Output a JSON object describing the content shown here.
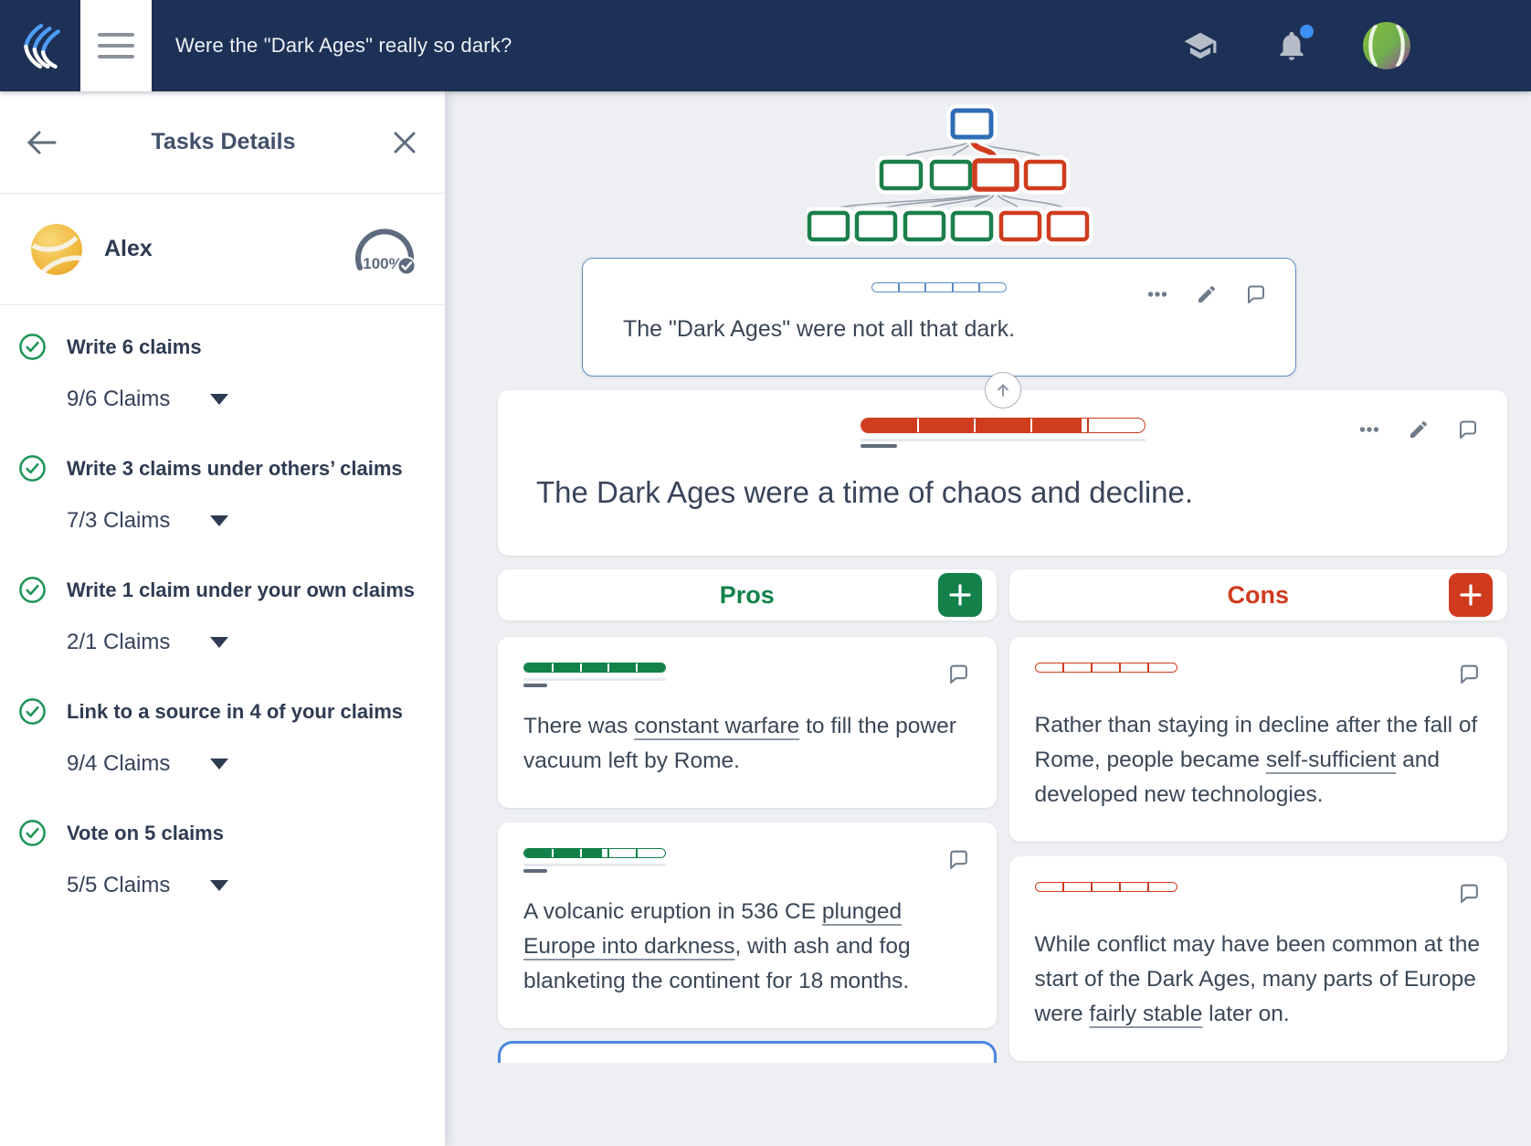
{
  "topbar": {
    "title": "Were the \"Dark Ages\" really so dark?",
    "icons": [
      "hamburger-menu",
      "school-cap",
      "notifications-bell",
      "user-avatar"
    ]
  },
  "sidebar": {
    "header": {
      "title": "Tasks Details"
    },
    "user": {
      "name": "Alex",
      "progress_label": "100%"
    },
    "tasks": [
      {
        "title": "Write 6 claims",
        "count": "9/6 Claims"
      },
      {
        "title": "Write 3 claims under others’ claims",
        "count": "7/3 Claims"
      },
      {
        "title": "Write 1 claim under your own claims",
        "count": "2/1 Claims"
      },
      {
        "title": "Link to a source in 4 of your claims",
        "count": "9/4 Claims"
      },
      {
        "title": "Vote on 5 claims",
        "count": "5/5 Claims"
      }
    ]
  },
  "main": {
    "thesis": {
      "text": "The \"Dark Ages\" were not all that dark.",
      "vote_bar": {
        "fill": 0
      }
    },
    "claim": {
      "text": "The Dark Ages were a time of chaos and decline.",
      "vote_bar": {
        "fill": 78
      }
    },
    "pros": {
      "label": "Pros",
      "cards": [
        {
          "vote_bar": {
            "fill": 100
          },
          "parts": [
            {
              "t": "There was "
            },
            {
              "t": "constant warfare",
              "u": true
            },
            {
              "t": " to fill the power vacuum left by Rome."
            }
          ]
        },
        {
          "vote_bar": {
            "fill": 55
          },
          "parts": [
            {
              "t": "A volcanic eruption in 536 CE "
            },
            {
              "t": "plunged Europe into darkness",
              "u": true
            },
            {
              "t": ", with ash and fog blanketing the continent for 18 months."
            }
          ]
        }
      ]
    },
    "cons": {
      "label": "Cons",
      "cards": [
        {
          "vote_bar": {
            "fill": 0
          },
          "parts": [
            {
              "t": "Rather than staying in decline after the fall of Rome, people became "
            },
            {
              "t": "self-sufficient",
              "u": true
            },
            {
              "t": " and developed new technologies."
            }
          ]
        },
        {
          "vote_bar": {
            "fill": 0
          },
          "parts": [
            {
              "t": "While conflict may have been common at the start of the Dark Ages, many parts of Europe were "
            },
            {
              "t": "fairly stable",
              "u": true
            },
            {
              "t": " later on."
            }
          ]
        }
      ]
    }
  },
  "colors": {
    "navy": "#1d3156",
    "bar": {
      "blue": "#5d8cc6",
      "green": "#12814a",
      "red": "#cf3c1e"
    },
    "accent_blue": "#4c86e0",
    "pro_green": "#12814a",
    "con_red": "#d03b1e"
  }
}
